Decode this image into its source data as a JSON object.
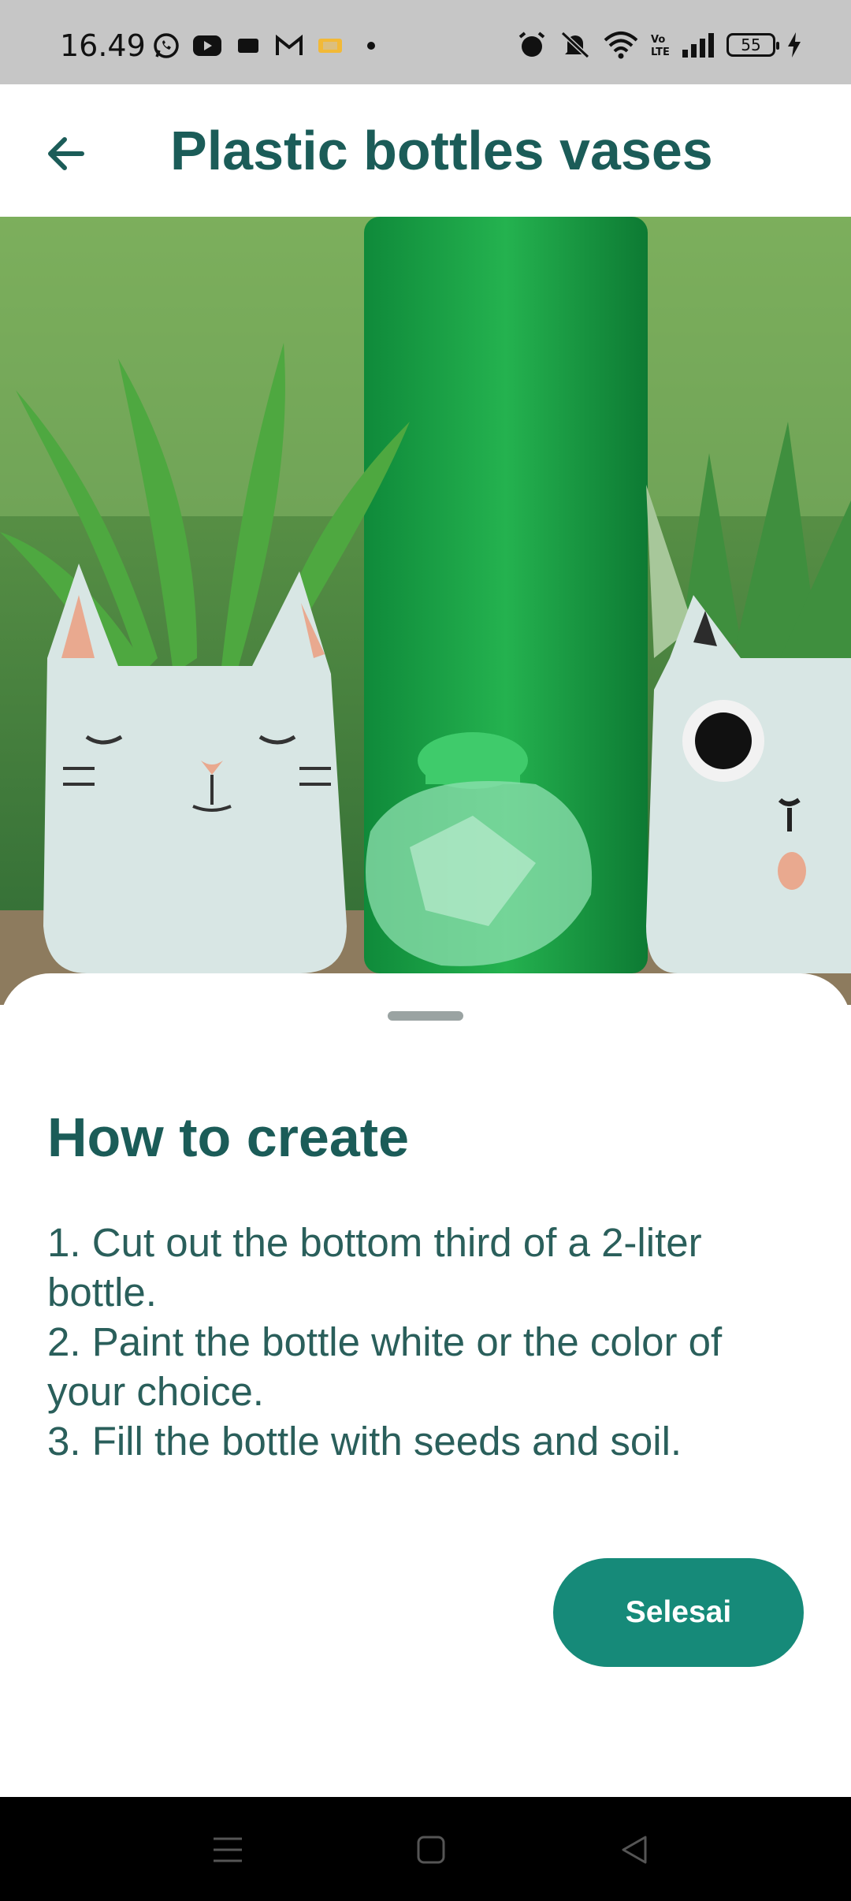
{
  "status_bar": {
    "time": "16.49",
    "battery_level": "55",
    "icons_left": [
      "whatsapp-icon",
      "youtube-icon",
      "film-icon",
      "gmail-icon",
      "app-icon",
      "dot-icon"
    ],
    "icons_right": [
      "alarm-icon",
      "mute-icon",
      "wifi-icon",
      "volte-icon",
      "signal-icon",
      "battery-icon",
      "charging-icon"
    ]
  },
  "app_bar": {
    "title": "Plastic bottles vases",
    "back_icon": "arrow-back-icon"
  },
  "hero_image": {
    "description_icon": "photo-bottle-vases",
    "palette": {
      "green": "#1fae4a",
      "white_bottle": "#d8e6e4",
      "leaf": "#3e9a3c"
    }
  },
  "sheet": {
    "heading": "How to create",
    "steps": [
      "1. Cut out the bottom third of a 2-liter bottle.",
      "2. Paint the bottle white or the color of your choice.",
      "3. Fill the bottle with seeds and soil."
    ],
    "done_label": "Selesai"
  },
  "colors": {
    "accent": "#168a79",
    "title": "#1b5c58",
    "text": "#2a5f5b"
  },
  "nav_bar": {
    "icons": [
      "menu-icon",
      "home-icon",
      "back-triangle-icon"
    ]
  }
}
